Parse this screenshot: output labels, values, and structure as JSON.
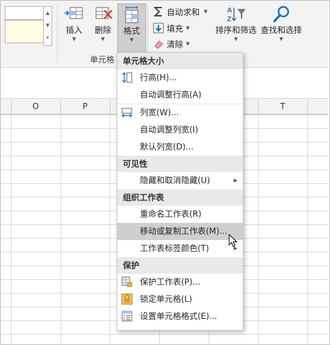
{
  "ribbon": {
    "insert_label": "插入",
    "delete_label": "删除",
    "format_label": "格式",
    "cells_group_label": "单元格",
    "autosum_label": "自动求和",
    "fill_label": "填充",
    "clear_label": "清除",
    "sort_filter_label": "排序和筛选",
    "find_select_label": "查找和选择"
  },
  "columns": [
    "O",
    "P",
    "T"
  ],
  "format_menu": {
    "sections": {
      "cell_size": "单元格大小",
      "visibility": "可见性",
      "organize_sheets": "组织工作表",
      "protection": "保护"
    },
    "items": {
      "row_height": "行高(H)...",
      "autofit_row_height": "自动调整行高(A)",
      "column_width": "列宽(W)...",
      "autofit_column_width": "自动调整列宽(I)",
      "default_width": "默认列宽(D)...",
      "hide_unhide": "隐藏和取消隐藏(U)",
      "rename_sheet": "重命名工作表(R)",
      "move_copy_sheet": "移动或复制工作表(M)...",
      "tab_color": "工作表标签颜色(T)",
      "protect_sheet": "保护工作表(P)...",
      "lock_cell": "锁定单元格(L)",
      "format_cells": "设置单元格格式(E)..."
    }
  },
  "colors": {
    "selected": "#cfcfcf",
    "accent": "#1e6fbf",
    "delete_red": "#d33b2c"
  }
}
